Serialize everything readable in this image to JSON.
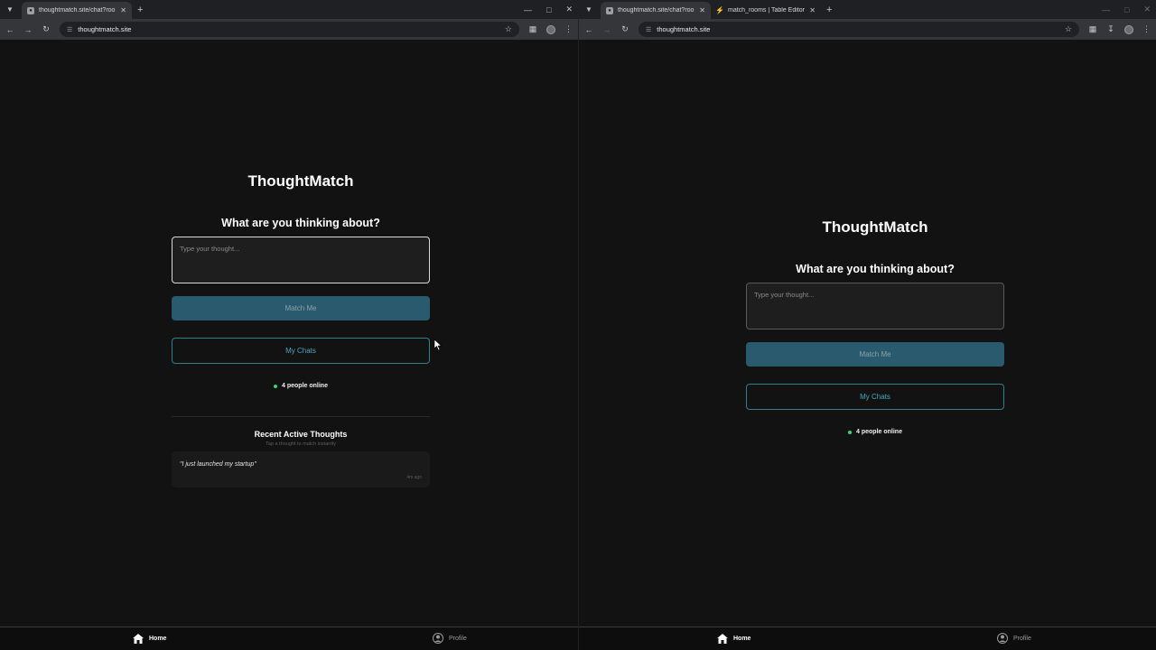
{
  "left_window": {
    "tabs": [
      {
        "title": "thoughtmatch.site/chat?room",
        "active": true
      }
    ],
    "url": "thoughtmatch.site",
    "page": {
      "app_title": "ThoughtMatch",
      "prompt": "What are you thinking about?",
      "input_placeholder": "Type your thought...",
      "match_button": "Match Me",
      "chats_button": "My Chats",
      "online_text": "4 people online",
      "recent_title": "Recent Active Thoughts",
      "recent_subtitle": "Tap a thought to match instantly",
      "thoughts": [
        {
          "text": "\"I just launched my startup\"",
          "time": "4m ago"
        }
      ]
    },
    "bottom_nav": {
      "home": "Home",
      "profile": "Profile"
    }
  },
  "right_window": {
    "tabs": [
      {
        "title": "thoughtmatch.site/chat?room",
        "active": true
      },
      {
        "title": "match_rooms | Table Editor | Th",
        "active": false
      }
    ],
    "url": "thoughtmatch.site",
    "page": {
      "app_title": "ThoughtMatch",
      "prompt": "What are you thinking about?",
      "input_placeholder": "Type your thought...",
      "match_button": "Match Me",
      "chats_button": "My Chats",
      "online_text": "4 people online"
    },
    "bottom_nav": {
      "home": "Home",
      "profile": "Profile"
    }
  },
  "colors": {
    "background": "#121212",
    "accent": "#295a6d",
    "accent_outline": "#2d7f8c",
    "online_dot": "#37d67a"
  }
}
